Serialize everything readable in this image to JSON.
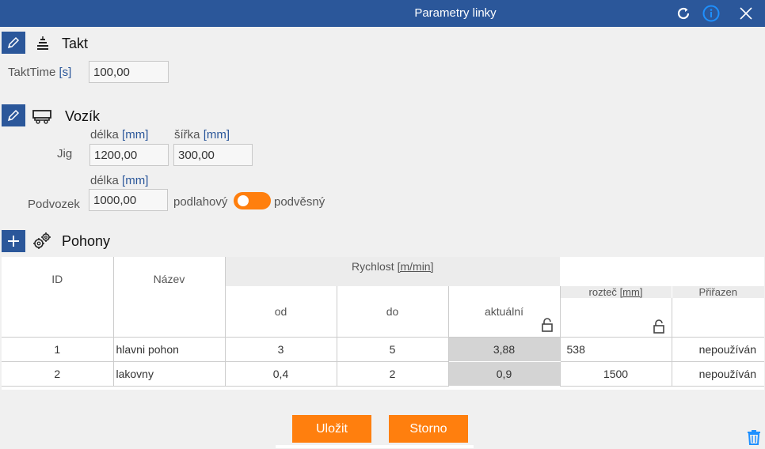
{
  "dialog": {
    "title": "Parametry linky"
  },
  "takt": {
    "title": "Takt",
    "takt_time_label": "TaktTime",
    "takt_time_unit": "[s]",
    "takt_time_value": "100,00"
  },
  "vozik": {
    "title": "Vozík",
    "jig_label": "Jig",
    "jig_length_label": "délka",
    "jig_length_unit": "[mm]",
    "jig_width_label": "šířka",
    "jig_width_unit": "[mm]",
    "jig_length_value": "1200,00",
    "jig_width_value": "300,00",
    "podvozek_label": "Podvozek",
    "podvozek_length_label": "délka",
    "podvozek_length_unit": "[mm]",
    "podvozek_length_value": "1000,00",
    "toggle_left_label": "podlahový",
    "toggle_right_label": "podvěsný"
  },
  "pohony": {
    "title": "Pohony",
    "headers": {
      "id": "ID",
      "nazev": "Název",
      "rychlost": "Rychlost",
      "rychlost_unit": "[m/min]",
      "od": "od",
      "do": "do",
      "aktualni": "aktuální",
      "roztec": "rozteč",
      "roztec_unit": "[mm]",
      "prirazen": "Přiřazen"
    },
    "rows": [
      {
        "id": "1",
        "nazev": "hlavni pohon",
        "od": "3",
        "do": "5",
        "aktualni": "3,88",
        "roztec": "538",
        "prirazen": "nepoužíván"
      },
      {
        "id": "2",
        "nazev": "lakovny",
        "od": "0,4",
        "do": "2",
        "aktualni": "0,9",
        "roztec": "1500",
        "prirazen": "nepoužíván"
      }
    ]
  },
  "buttons": {
    "save": "Uložit",
    "cancel": "Storno"
  },
  "colors": {
    "titlebar": "#2b579a",
    "accent": "#ff7f0e",
    "unit_text": "#2b579a",
    "locked_cell": "#d4d4d4"
  },
  "icons": [
    "refresh-icon",
    "info-icon",
    "close-icon",
    "pencil-icon",
    "stack-icon",
    "cart-icon",
    "plus-icon",
    "gears-icon",
    "lock-icon",
    "trash-icon"
  ]
}
